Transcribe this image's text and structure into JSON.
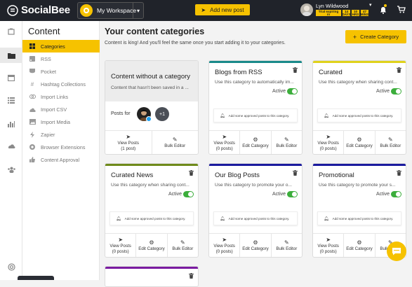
{
  "app": {
    "brand": "SocialBee",
    "workspace": "My Workspace",
    "add_post": "Add new post"
  },
  "user": {
    "name": "Lyn Wildwood",
    "trial_label": "Trial expiring in",
    "days": "14 DAYS",
    "hours": "10 HRS",
    "mins": "47 MINS"
  },
  "rail": [
    "dashboard-icon",
    "content-folder-icon",
    "calendar-icon",
    "list-icon",
    "analytics-icon",
    "cloud-icon",
    "audience-icon",
    "help-icon"
  ],
  "content_nav": {
    "title": "Content",
    "items": [
      {
        "label": "Categories",
        "icon": "grid-icon"
      },
      {
        "label": "RSS",
        "icon": "rss-icon"
      },
      {
        "label": "Pocket",
        "icon": "pocket-icon"
      },
      {
        "label": "Hashtag Collections",
        "icon": "hashtag-icon"
      },
      {
        "label": "Import Links",
        "icon": "link-icon"
      },
      {
        "label": "Import CSV",
        "icon": "upload-icon"
      },
      {
        "label": "Import Media",
        "icon": "image-icon"
      },
      {
        "label": "Zapier",
        "icon": "zapier-icon"
      },
      {
        "label": "Browser Extensions",
        "icon": "browser-icon"
      },
      {
        "label": "Content Approval",
        "icon": "thumbs-up-icon"
      }
    ]
  },
  "main": {
    "title": "Your content categories",
    "subtitle": "Content is king! And you'll feel the same once you start adding it to your categories.",
    "create_label": "Create Category"
  },
  "cards": [
    {
      "title": "Content without a category",
      "desc": "Content that hasn't been saved in a ...",
      "posts_for": "Posts for",
      "more": "+1",
      "view": "View Posts",
      "count": "(1 post)",
      "bulk": "Bulk Editor"
    },
    {
      "title": "Blogs from RSS",
      "desc": "Use this category to automatically im...",
      "active": "Active",
      "empty": "Add some approved posts to this category.",
      "view": "View Posts",
      "count": "(0 posts)",
      "edit": "Edit Category",
      "bulk": "Bulk Editor",
      "color": "#1a8a8a"
    },
    {
      "title": "Curated",
      "desc": "Use this category when sharing cont...",
      "active": "Active",
      "empty": "Add some approved posts to this category.",
      "view": "View Posts",
      "count": "(0 posts)",
      "edit": "Edit Category",
      "bulk": "Bulk Editor",
      "color": "#e0d21c"
    },
    {
      "title": "Curated News",
      "desc": "Use this category when sharing cont...",
      "active": "Active",
      "empty": "Add some approved posts to this category.",
      "view": "View Posts",
      "count": "(0 posts)",
      "edit": "Edit Category",
      "bulk": "Bulk Editor",
      "color": "#6e8a1a"
    },
    {
      "title": "Our Blog Posts",
      "desc": "Use this category to promote your o...",
      "active": "Active",
      "empty": "Add some approved posts to this category.",
      "view": "View Posts",
      "count": "(0 posts)",
      "edit": "Edit Category",
      "bulk": "Bulk Editor",
      "color": "#1a1a9e"
    },
    {
      "title": "Promotional",
      "desc": "Use this category to promote your s...",
      "active": "Active",
      "empty": "Add some approved posts to this category.",
      "view": "View Posts",
      "count": "(0 posts)",
      "edit": "Edit Category",
      "bulk": "Bulk Editor",
      "color": "#1a1a9e"
    }
  ],
  "colors": {
    "accent": "#f6c200",
    "topbar": "#20232a",
    "toggle_on": "#3cae3c",
    "partial_card": "#7a1aa0"
  }
}
